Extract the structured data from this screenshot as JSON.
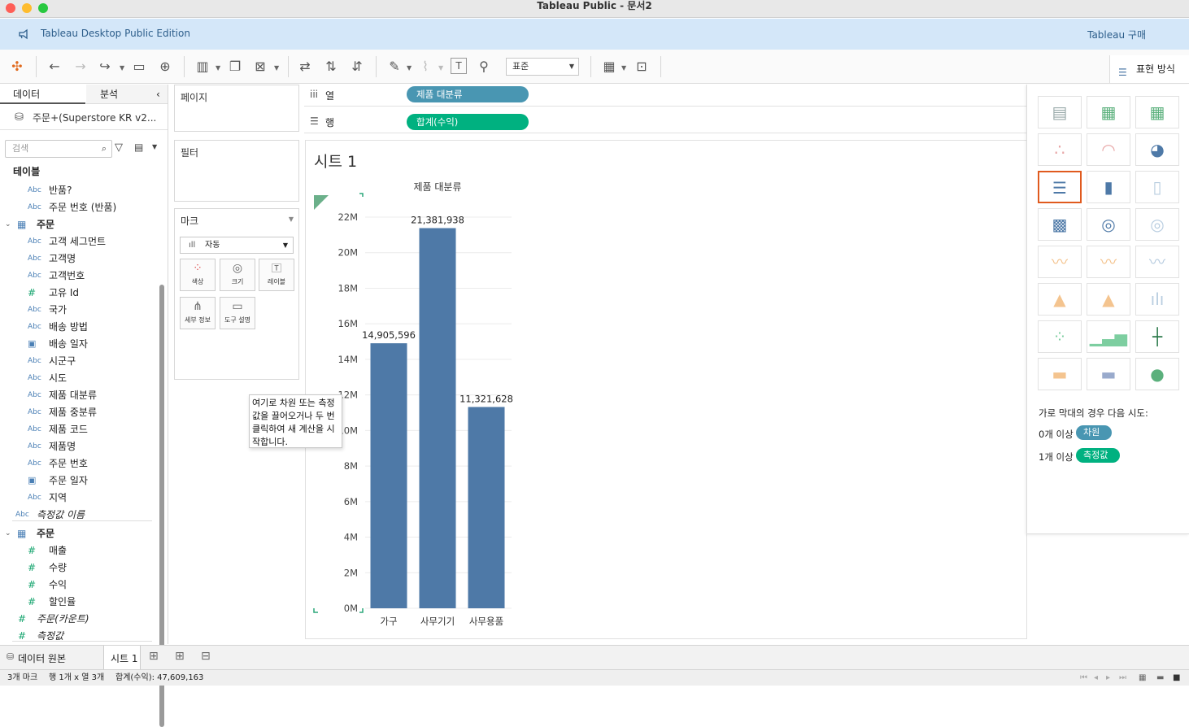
{
  "window": {
    "title": "Tableau Public - 문서2"
  },
  "banner": {
    "text": "Tableau Desktop Public Edition",
    "buy": "Tableau 구매"
  },
  "toolbar": {
    "fit": "표준",
    "show_me": "표현 방식"
  },
  "data_pane": {
    "tab_data": "데이터",
    "tab_analysis": "분석",
    "datasource": "주문+(Superstore KR v2...",
    "search_placeholder": "검색",
    "tables_label": "테이블",
    "fields": [
      {
        "type": "Abc",
        "name": "반품?"
      },
      {
        "type": "Abc",
        "name": "주문 번호 (반품)"
      },
      {
        "type": "table",
        "name": "주문"
      },
      {
        "type": "Abc",
        "name": "고객 세그먼트"
      },
      {
        "type": "Abc",
        "name": "고객명"
      },
      {
        "type": "Abc",
        "name": "고객번호"
      },
      {
        "type": "#",
        "name": "고유 Id"
      },
      {
        "type": "Abc",
        "name": "국가"
      },
      {
        "type": "Abc",
        "name": "배송 방법"
      },
      {
        "type": "date",
        "name": "배송 일자"
      },
      {
        "type": "Abc",
        "name": "시군구"
      },
      {
        "type": "Abc",
        "name": "시도"
      },
      {
        "type": "Abc",
        "name": "제품 대분류"
      },
      {
        "type": "Abc",
        "name": "제품 중분류"
      },
      {
        "type": "Abc",
        "name": "제품 코드"
      },
      {
        "type": "Abc",
        "name": "제품명"
      },
      {
        "type": "Abc",
        "name": "주문 번호"
      },
      {
        "type": "date",
        "name": "주문 일자"
      },
      {
        "type": "Abc",
        "name": "지역"
      },
      {
        "type": "Abc",
        "name": "측정값 이름"
      },
      {
        "type": "table",
        "name": "주문"
      },
      {
        "type": "#",
        "name": "매출"
      },
      {
        "type": "#",
        "name": "수량"
      },
      {
        "type": "#",
        "name": "수익"
      },
      {
        "type": "#",
        "name": "할인율"
      },
      {
        "type": "#",
        "name": "주문(카운트)"
      },
      {
        "type": "#",
        "name": "측정값"
      }
    ]
  },
  "cards": {
    "pages": "페이지",
    "filters": "필터",
    "marks": "마크",
    "mark_type": "자동",
    "color": "색상",
    "size": "크기",
    "label": "레이블",
    "detail": "세부 정보",
    "tooltip": "도구 설명"
  },
  "shelves": {
    "columns_label": "열",
    "rows_label": "행",
    "columns_pill": "제품 대분류",
    "rows_pill": "합계(수익)"
  },
  "sheet": {
    "title": "시트 1"
  },
  "tooltip_text": "여기로 차원 또는 측정값을 끌어오거나 두 번 클릭하여 새 계산을 시작합니다.",
  "chart_data": {
    "type": "bar",
    "title": "제품 대분류",
    "categories": [
      "가구",
      "사무기기",
      "사무용품"
    ],
    "values": [
      14905596,
      21381938,
      11321628
    ],
    "value_labels": [
      "14,905,596",
      "21,381,938",
      "11,321,628"
    ],
    "ylim": [
      0,
      22000000
    ],
    "yticks": [
      "0M",
      "2M",
      "4M",
      "6M",
      "8M",
      "10M",
      "12M",
      "14M",
      "16M",
      "18M",
      "20M",
      "22M"
    ],
    "bar_color": "#4e79a7",
    "grid": true
  },
  "show_me": {
    "hint": "가로 막대의 경우 다음 시도:",
    "req1_prefix": "0개 이상",
    "req1_pill": "차원",
    "req2_prefix": "1개 이상",
    "req2_pill": "측정값"
  },
  "bottom_tabs": {
    "datasource": "데이터 원본",
    "sheet": "시트 1"
  },
  "status": {
    "marks": "3개 마크",
    "rows_cols": "행 1개 x 열 3개",
    "sum": "합계(수익): 47,609,163"
  },
  "colors": {
    "dimension_pill": "#4996b2",
    "measure_pill": "#00b180",
    "accent": "#e05a1e"
  }
}
